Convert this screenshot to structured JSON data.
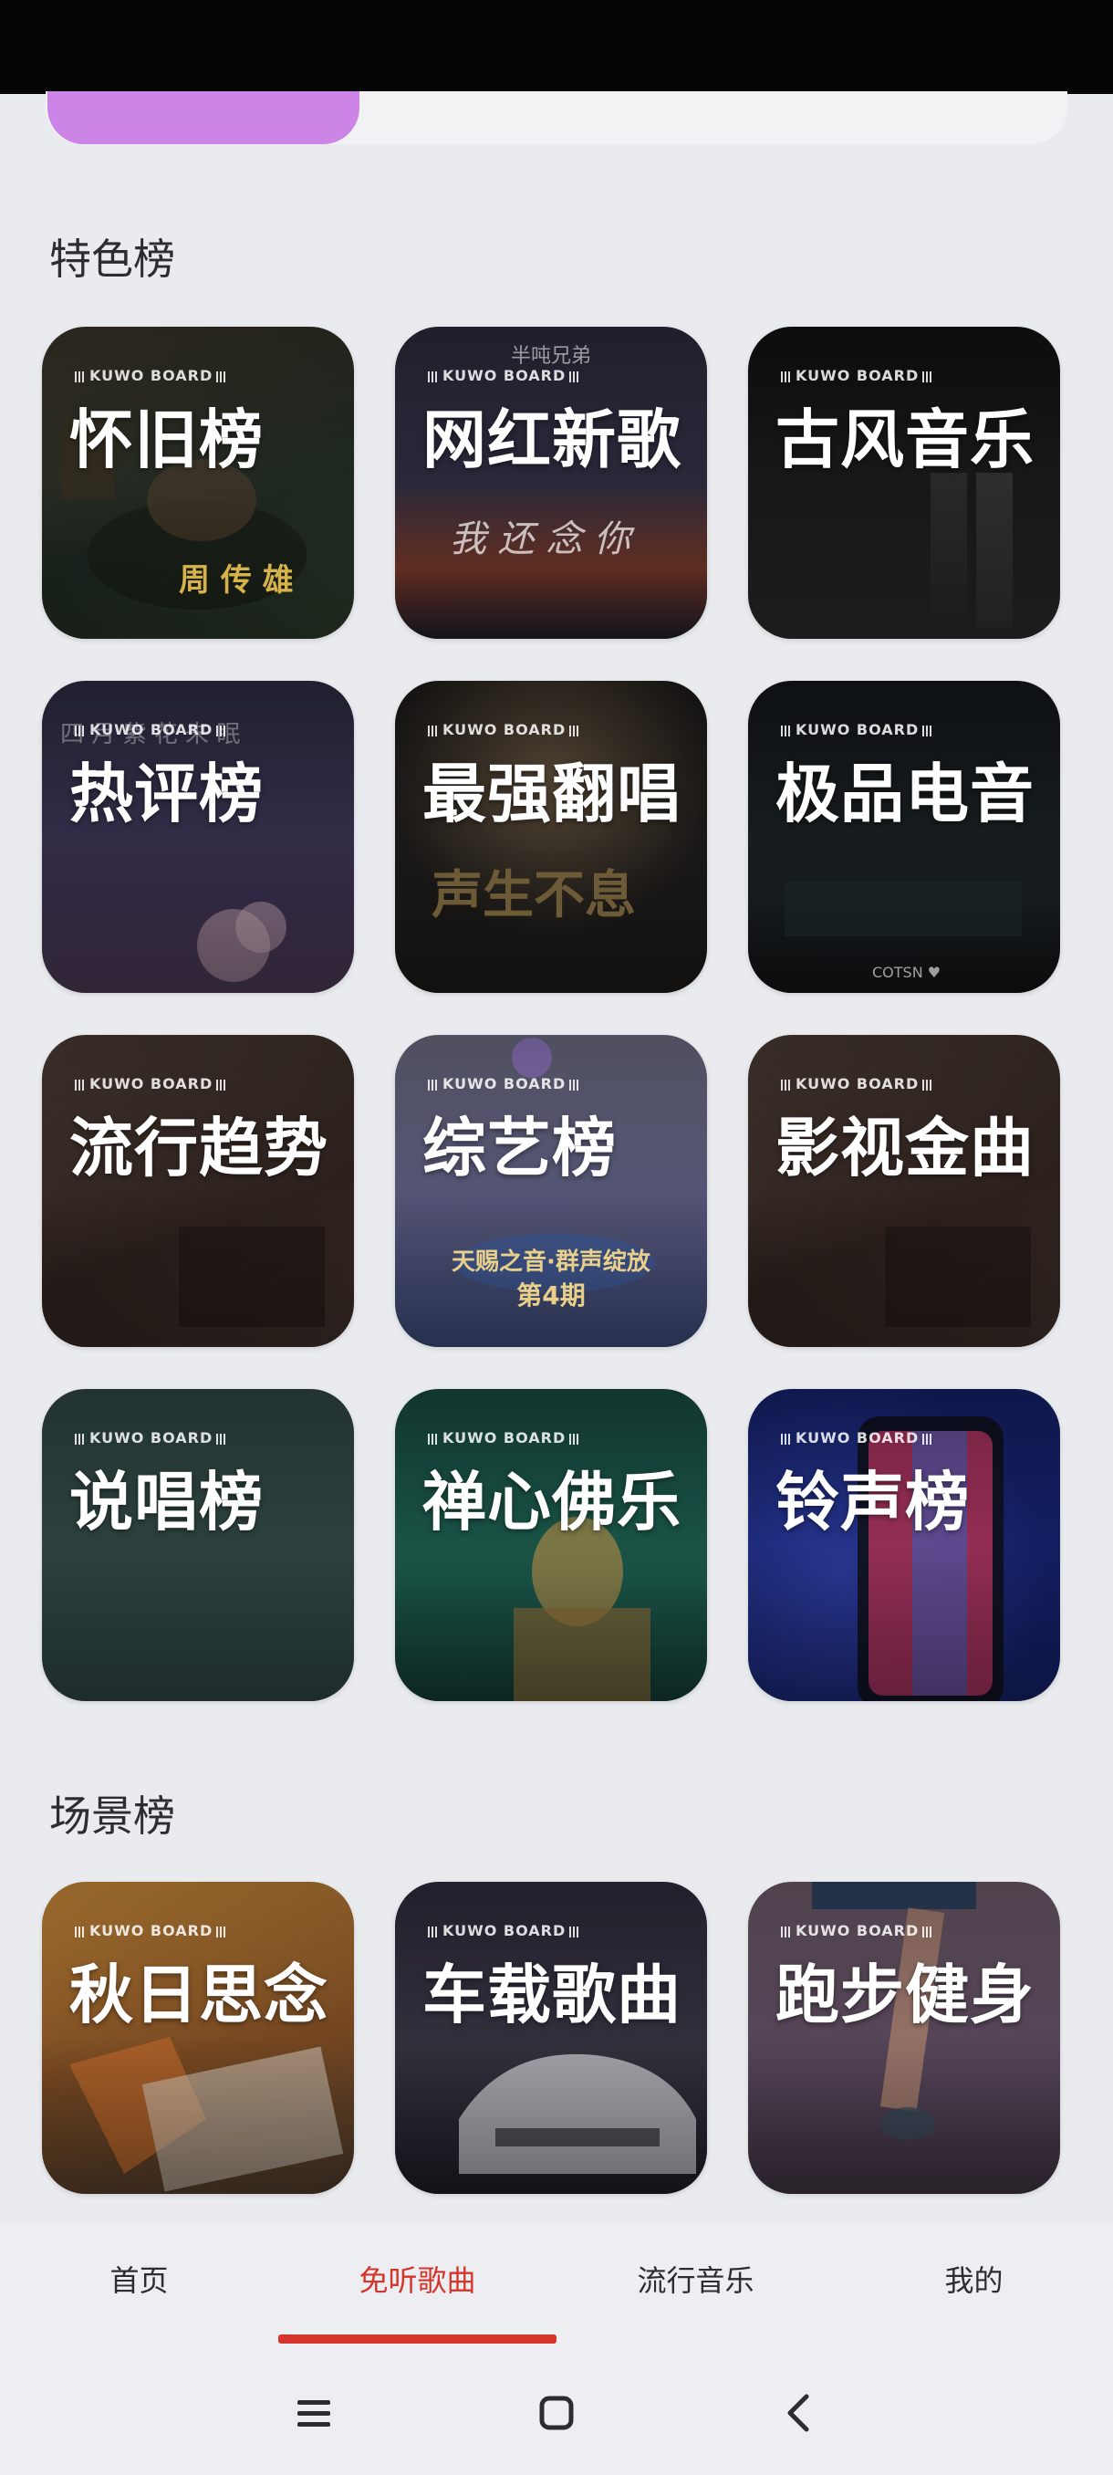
{
  "sections": {
    "featured_title": "特色榜",
    "scene_title": "场景榜"
  },
  "brand_tag": "KUWO BOARD",
  "featured_cards": [
    {
      "title": "怀旧榜",
      "caption": "周 传 雄",
      "color": "#2b2e26"
    },
    {
      "title": "网红新歌",
      "caption": "我 还 念 你",
      "top_caption": "半吨兄弟",
      "color": "#2a2836"
    },
    {
      "title": "古风音乐",
      "caption": "",
      "color": "#141414"
    },
    {
      "title": "热评榜",
      "caption": "",
      "top_caption": "四 月 紫 花 未 眠",
      "color": "#2e2a40"
    },
    {
      "title": "最强翻唱",
      "caption": "声生不息",
      "color": "#1c1a18"
    },
    {
      "title": "极品电音",
      "caption": "",
      "bottom_caption": "COTSN ♥",
      "color": "#15191a"
    },
    {
      "title": "流行趋势",
      "caption": "",
      "color": "#3b2e28"
    },
    {
      "title": "综艺榜",
      "caption": "天赐之音·群声绽放",
      "subcaption": "第4期",
      "color": "#5a5a72"
    },
    {
      "title": "影视金曲",
      "caption": "",
      "color": "#3b2e28"
    },
    {
      "title": "说唱榜",
      "caption": "",
      "color": "#2b403d"
    },
    {
      "title": "禅心佛乐",
      "caption": "",
      "color": "#1c4a40"
    },
    {
      "title": "铃声榜",
      "caption": "",
      "color": "#1a2a6b"
    }
  ],
  "scene_cards": [
    {
      "title": "秋日思念",
      "color": "#8a5a2a"
    },
    {
      "title": "车载歌曲",
      "color": "#2d2a3a"
    },
    {
      "title": "跑步健身",
      "color": "#56455a"
    }
  ],
  "bottom_nav": [
    {
      "label": "首页",
      "active": false
    },
    {
      "label": "免听歌曲",
      "active": true
    },
    {
      "label": "流行音乐",
      "active": false
    },
    {
      "label": "我的",
      "active": false
    }
  ],
  "colors": {
    "accent": "#d6352b",
    "pill": "#cc84e6",
    "background": "#e9ebee"
  },
  "system_nav": [
    "menu-icon",
    "home-icon",
    "back-icon"
  ]
}
